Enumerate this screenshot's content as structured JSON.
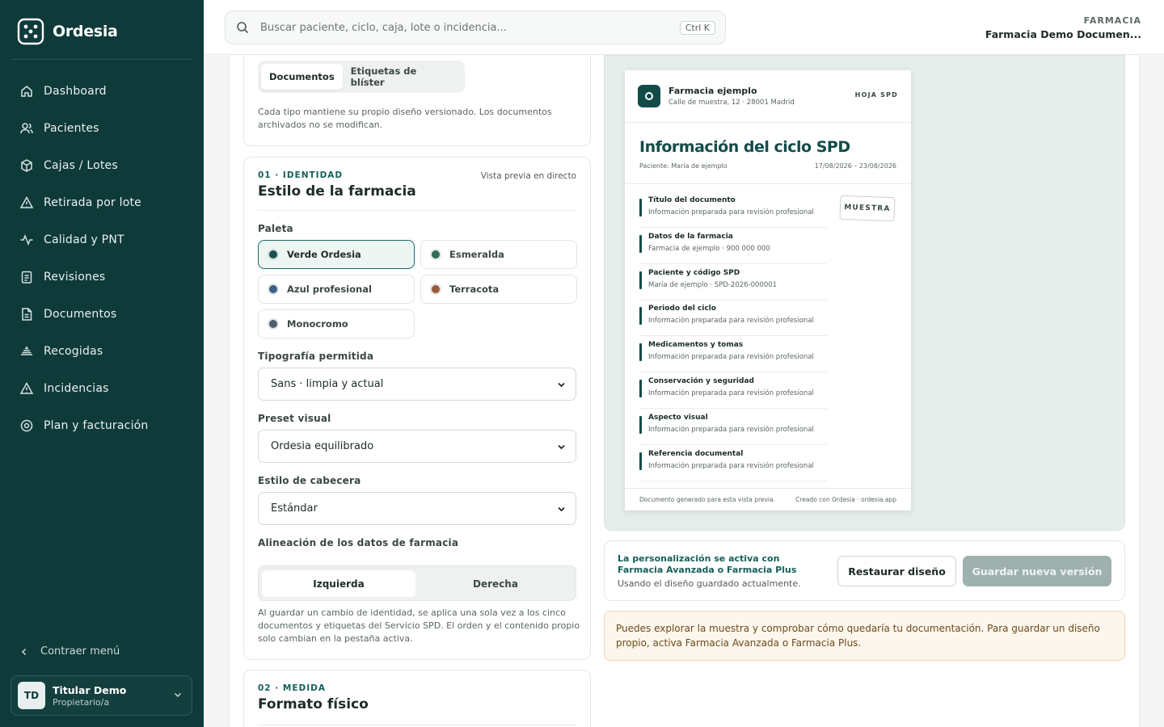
{
  "brand": {
    "name": "Ordesia"
  },
  "sidebar": {
    "items": [
      {
        "label": "Dashboard",
        "icon": "home-icon"
      },
      {
        "label": "Pacientes",
        "icon": "users-icon"
      },
      {
        "label": "Cajas / Lotes",
        "icon": "box-icon"
      },
      {
        "label": "Retirada por lote",
        "icon": "alert-triangle-icon"
      },
      {
        "label": "Calidad y PNT",
        "icon": "activity-icon"
      },
      {
        "label": "Revisiones",
        "icon": "clipboard-icon"
      },
      {
        "label": "Documentos",
        "icon": "file-icon"
      },
      {
        "label": "Recogidas",
        "icon": "pickup-icon"
      },
      {
        "label": "Incidencias",
        "icon": "warning-icon"
      },
      {
        "label": "Plan y facturación",
        "icon": "settings-icon"
      }
    ],
    "collapse_label": "Contraer menú",
    "user": {
      "initials": "TD",
      "name": "Titular Demo",
      "role": "Propietario/a"
    }
  },
  "topbar": {
    "search_placeholder": "Buscar paciente, ciclo, caja, lote o incidencia...",
    "shortcut": "Ctrl K",
    "pharmacy_label": "FARMACIA",
    "pharmacy_name": "Farmacia Demo Documen..."
  },
  "doc_types": {
    "tabs": [
      "Documentos",
      "Etiquetas de blíster"
    ],
    "active": 0,
    "note": "Cada tipo mantiene su propio diseño versionado. Los documentos archivados no se modifican."
  },
  "identity": {
    "eyebrow": "01 · IDENTIDAD",
    "title": "Estilo de la farmacia",
    "live_preview": "Vista previa en directo",
    "palette_label": "Paleta",
    "palettes": [
      {
        "name": "Verde Ordesia",
        "color": "#1c4f4b",
        "selected": true
      },
      {
        "name": "Esmeralda",
        "color": "#2f6b58",
        "selected": false
      },
      {
        "name": "Azul profesional",
        "color": "#3a6185",
        "selected": false
      },
      {
        "name": "Terracota",
        "color": "#9a5a3d",
        "selected": false
      },
      {
        "name": "Monocromo",
        "color": "#4f5c70",
        "selected": false
      }
    ],
    "font_label": "Tipografía permitida",
    "font_value": "Sans · limpia y actual",
    "preset_label": "Preset visual",
    "preset_value": "Ordesia equilibrado",
    "header_label": "Estilo de cabecera",
    "header_value": "Estándar",
    "align_label": "Alineación de los datos de farmacia",
    "align_options": [
      "Izquierda",
      "Derecha"
    ],
    "align_active": 0,
    "footnote": "Al guardar un cambio de identidad, se aplica una sola vez a los cinco documentos y etiquetas del Servicio SPD. El orden y el contenido propio solo cambian en la pestaña activa."
  },
  "measure": {
    "eyebrow": "02 · MEDIDA",
    "title": "Formato físico"
  },
  "preview_doc": {
    "org": "Farmacia ejemplo",
    "address": "Calle de muestra, 12 · 28001 Madrid",
    "tag": "HOJA SPD",
    "title": "Información del ciclo SPD",
    "patient": "Paciente: María de ejemplo",
    "dates": "17/08/2026 – 23/08/2026",
    "stamp": "MUESTRA",
    "rows": [
      {
        "t": "Título del documento",
        "d": "Información preparada para revisión profesional"
      },
      {
        "t": "Datos de la farmacia",
        "d": "Farmacia de ejemplo · 900 000 000"
      },
      {
        "t": "Paciente y código SPD",
        "d": "María de ejemplo · SPD-2026-000001"
      },
      {
        "t": "Periodo del ciclo",
        "d": "Información preparada para revisión profesional"
      },
      {
        "t": "Medicamentos y tomas",
        "d": "Información preparada para revisión profesional"
      },
      {
        "t": "Conservación y seguridad",
        "d": "Información preparada para revisión profesional"
      },
      {
        "t": "Aspecto visual",
        "d": "Información preparada para revisión profesional"
      },
      {
        "t": "Referencia documental",
        "d": "Información preparada para revisión profesional"
      }
    ],
    "footer_left": "Documento generado para esta vista previa.",
    "footer_right": "Creado con Ordesia · ordesia.app"
  },
  "actions": {
    "title": "La personalización se activa con Farmacia Avanzada o Farmacia Plus",
    "subtitle": "Usando el diseño guardado actualmente.",
    "reset": "Restaurar diseño",
    "save": "Guardar nueva versión"
  },
  "warning": "Puedes explorar la muestra y comprobar cómo quedaría tu documentación. Para guardar un diseño propio, activa Farmacia Avanzada o Farmacia Plus.",
  "colors": {
    "brand": "#0f3a3a",
    "accent": "#124c49",
    "save_disabled": "#9fb1ae"
  }
}
